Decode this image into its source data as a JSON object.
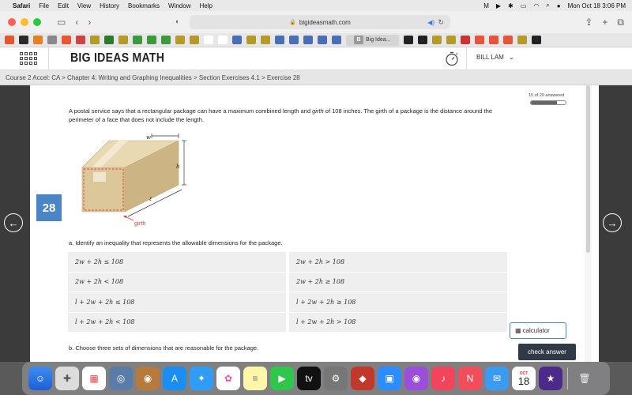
{
  "menubar": {
    "app": "Safari",
    "items": [
      "File",
      "Edit",
      "View",
      "History",
      "Bookmarks",
      "Window",
      "Help"
    ],
    "datetime": "Mon Oct 18  3:06 PM"
  },
  "browser": {
    "url": "bigideasmath.com",
    "active_bookmark_tab": "Big Idea..."
  },
  "site": {
    "brand": "BIG IDEAS MATH",
    "user": "BILL LAM",
    "breadcrumb": "Course 2 Accel: CA > Chapter 4: Writing and Graphing Inequalities > Section Exercises 4.1 > Exercise 28"
  },
  "exercise": {
    "number": "28",
    "progress_text": "15 of 20 answered",
    "progress_fraction": 0.75,
    "problem_part1": "A postal service says that a rectangular package can have a maximum combined length and ",
    "problem_italic": "girth",
    "problem_part2": " of 108 inches. The girth of a package is the distance around the perimeter of a face that does not include the length.",
    "figure_labels": {
      "w": "w",
      "h": "h",
      "l": "ℓ",
      "girth": "girth"
    },
    "part_a": "a. Identify an inequality that represents the allowable dimensions for the package.",
    "choices": [
      "2w + 2h ≤ 108",
      "2w + 2h > 108",
      "2w + 2h < 108",
      "2w + 2h ≥ 108",
      "l + 2w + 2h ≤ 108",
      "l + 2w + 2h ≥ 108",
      "l + 2w + 2h < 108",
      "l + 2w + 2h > 108"
    ],
    "part_b": "b. Choose three sets of dimensions that are reasonable for the package.",
    "calculator_label": "calculator",
    "check_label": "check answer"
  },
  "dock": {
    "calendar_month": "OCT",
    "calendar_day": "18"
  }
}
